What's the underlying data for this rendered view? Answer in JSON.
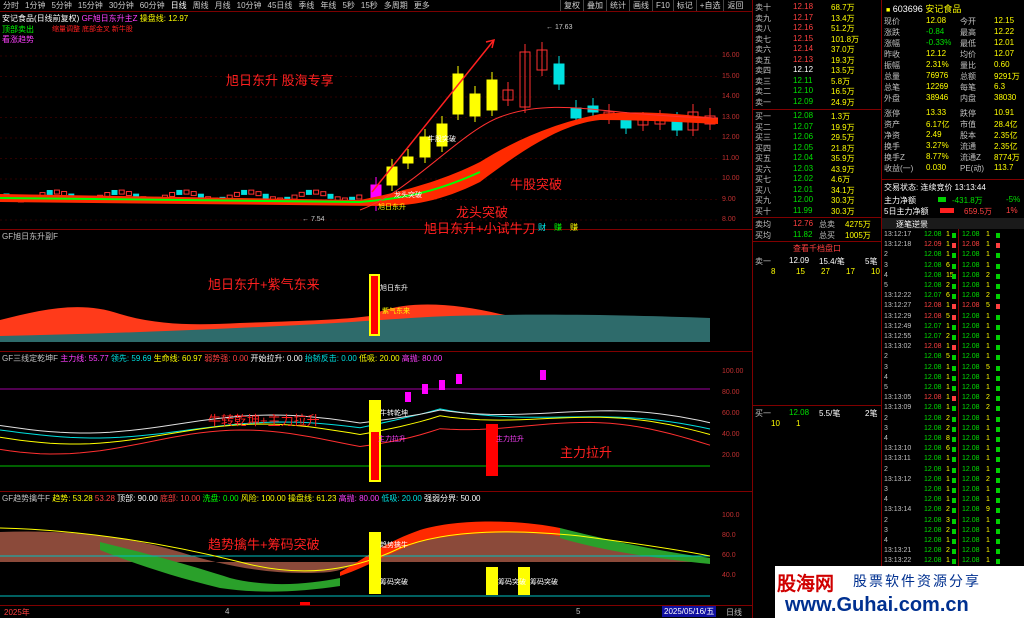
{
  "topbar": {
    "periods": [
      "分时",
      "1分钟",
      "5分钟",
      "15分钟",
      "30分钟",
      "60分钟",
      "日线",
      "周线",
      "月线",
      "10分钟",
      "45日线",
      "季线",
      "年线",
      "5秒",
      "15秒",
      "多周期",
      "更多"
    ],
    "tools": [
      "复权",
      "叠加",
      "统计",
      "画线",
      "F10",
      "标记",
      "+自选",
      "返回"
    ]
  },
  "main_pane": {
    "title": "安记食品(日线前复权)",
    "indicator": "GF旭日东升主Z",
    "indicator_label": "操盘线: 12.97",
    "legend": [
      "顶部卖出",
      "看涨趋势"
    ],
    "subtitle_line": "缩量调整 底部金叉 新牛股",
    "y_ticks": [
      "16.00",
      "15.00",
      "14.00",
      "13.00",
      "12.00",
      "11.00",
      "10.00",
      "9.00",
      "8.00"
    ],
    "max_label": "17.63",
    "min_label": "7.54",
    "annotations": [
      "旭日东升 股海专享",
      "牛股突破",
      "龙头突破",
      "旭日东升+小试牛刀"
    ],
    "mini_labels": [
      "牛股突破",
      "龙头突破",
      "旭日东升"
    ],
    "side_labels": [
      "财",
      "赚",
      "赚"
    ]
  },
  "pane2": {
    "title": "GF旭日东升副F",
    "annotation": "旭日东升+紫气东来",
    "labels": [
      "旭日东升",
      "紫气东来"
    ]
  },
  "pane3": {
    "title": "GF三线定乾坤F",
    "params": [
      "主力线: 55.77",
      "领先: 59.69",
      "生命线: 60.97",
      "弱势强: 0.00",
      "开始拉升: 0.00",
      "抬轿反击: 0.00",
      "低吸: 20.00",
      "高抛: 80.00"
    ],
    "y_ticks": [
      "100.00",
      "80.00",
      "60.00",
      "40.00",
      "20.00"
    ],
    "annotations": [
      "牛转乾坤+主力拉升",
      "主力拉升"
    ],
    "labels": [
      "牛转乾坤",
      "主力拉升",
      "主力拉升"
    ]
  },
  "pane4": {
    "title": "GF趋势擒牛F",
    "params": [
      "趋势: 53.28",
      "53.28",
      "顶部: 90.00",
      "底部: 10.00",
      "洗盘: 0.00",
      "风险: 100.00",
      "操盘线: 61.23",
      "高抛: 80.00",
      "低吸: 20.00",
      "强弱分界: 50.00"
    ],
    "y_ticks": [
      "100.0",
      "80.0",
      "60.0",
      "40.0"
    ],
    "annotation": "趋势擒牛+筹码突破",
    "labels": [
      "趋势擒牛",
      "筹码突破",
      "筹码突破",
      "筹码突破"
    ]
  },
  "footer": {
    "left": "2025年",
    "tick1": "4",
    "tick2": "5",
    "date": "2025/05/16/五",
    "right": "日线"
  },
  "stock": {
    "code": "603696",
    "name": "安记食品"
  },
  "orderbook": {
    "asks": [
      {
        "label": "卖十",
        "price": "12.18",
        "vol": "68.7万"
      },
      {
        "label": "卖九",
        "price": "12.17",
        "vol": "13.4万"
      },
      {
        "label": "卖八",
        "price": "12.16",
        "vol": "51.2万"
      },
      {
        "label": "卖七",
        "price": "12.15",
        "vol": "101.8万"
      },
      {
        "label": "卖六",
        "price": "12.14",
        "vol": "37.0万"
      },
      {
        "label": "卖五",
        "price": "12.13",
        "vol": "19.3万"
      },
      {
        "label": "卖四",
        "price": "12.12",
        "vol": "13.5万"
      },
      {
        "label": "卖三",
        "price": "12.11",
        "vol": "5.8万"
      },
      {
        "label": "卖二",
        "price": "12.10",
        "vol": "16.5万"
      },
      {
        "label": "卖一",
        "price": "12.09",
        "vol": "24.9万"
      }
    ],
    "bids": [
      {
        "label": "买一",
        "price": "12.08",
        "vol": "1.3万"
      },
      {
        "label": "买二",
        "price": "12.07",
        "vol": "19.9万"
      },
      {
        "label": "买三",
        "price": "12.06",
        "vol": "29.5万"
      },
      {
        "label": "买四",
        "price": "12.05",
        "vol": "21.8万"
      },
      {
        "label": "买五",
        "price": "12.04",
        "vol": "35.9万"
      },
      {
        "label": "买六",
        "price": "12.03",
        "vol": "43.9万"
      },
      {
        "label": "买七",
        "price": "12.02",
        "vol": "4.6万"
      },
      {
        "label": "买八",
        "price": "12.01",
        "vol": "34.1万"
      },
      {
        "label": "买九",
        "price": "12.00",
        "vol": "30.3万"
      },
      {
        "label": "买十",
        "price": "11.99",
        "vol": "30.3万"
      }
    ],
    "avg_ask": {
      "label": "卖均",
      "price": "12.76",
      "tot_label": "总卖",
      "tot": "4275万"
    },
    "avg_bid": {
      "label": "买均",
      "price": "11.82",
      "tot_label": "总买",
      "tot": "1005万"
    },
    "view_queue": "查看千档盘口",
    "sell1_queue": {
      "label": "卖一",
      "price": "12.09",
      "vol": "15.4/笔",
      "cnt": "5笔",
      "nums": [
        "8",
        "15",
        "27",
        "17",
        "10"
      ]
    },
    "buy1_queue": {
      "label": "买一",
      "price": "12.08",
      "vol": "5.5/笔",
      "cnt": "2笔",
      "nums": [
        "10",
        "1"
      ]
    }
  },
  "quote": {
    "rows": [
      {
        "l": "现价",
        "lv": "12.08",
        "r": "今开",
        "rv": "12.15"
      },
      {
        "l": "涨跌",
        "lv": "-0.84",
        "r": "最高",
        "rv": "12.22"
      },
      {
        "l": "涨幅",
        "lv": "-0.33%",
        "r": "最低",
        "rv": "12.01"
      },
      {
        "l": "昨收",
        "lv": "12.12",
        "r": "均价",
        "rv": "12.07"
      },
      {
        "l": "振幅",
        "lv": "2.31%",
        "r": "量比",
        "rv": "0.60"
      },
      {
        "l": "总量",
        "lv": "76976",
        "r": "总额",
        "rv": "9291万"
      },
      {
        "l": "总笔",
        "lv": "12269",
        "r": "每笔",
        "rv": "6.3"
      },
      {
        "l": "外盘",
        "lv": "38946",
        "r": "内盘",
        "rv": "38030"
      },
      {
        "l": "涨停",
        "lv": "13.33",
        "r": "跌停",
        "rv": "10.91"
      },
      {
        "l": "资产",
        "lv": "6.17亿",
        "r": "市值",
        "rv": "28.4亿"
      },
      {
        "l": "净资",
        "lv": "2.49",
        "r": "股本",
        "rv": "2.35亿"
      },
      {
        "l": "换手",
        "lv": "3.27%",
        "r": "流通",
        "rv": "2.35亿"
      },
      {
        "l": "换手Z",
        "lv": "8.77%",
        "r": "流通Z",
        "rv": "8774万"
      },
      {
        "l": "收益(一)",
        "lv": "0.030",
        "r": "PE(动)",
        "rv": "113.7"
      }
    ],
    "trade_status": "交易状态: 连续竞价 13:13:44",
    "main_net": {
      "label": "主力净额",
      "val": "-431.8万",
      "pct": "-5%"
    },
    "main_net5": {
      "label": "5日主力净额",
      "val": "659.5万",
      "pct": "1%"
    },
    "tick_header": "逐笔逆景"
  },
  "ticks": [
    {
      "t": "13:12:17",
      "p": "12.08",
      "v": "1",
      "c": "#00d000"
    },
    {
      "t": "13:12:18",
      "p": "12.09",
      "v": "1",
      "c": "#ff4040"
    },
    {
      "t": "2",
      "p": "12.08",
      "v": "1",
      "c": "#00d000"
    },
    {
      "t": "3",
      "p": "12.08",
      "v": "6",
      "c": "#00d000"
    },
    {
      "t": "4",
      "p": "12.08",
      "v": "15",
      "c": "#00d000"
    },
    {
      "t": "5",
      "p": "12.08",
      "v": "2",
      "c": "#00d000"
    },
    {
      "t": "13:12:22",
      "p": "12.07",
      "v": "6",
      "c": "#00d000"
    },
    {
      "t": "13:12:27",
      "p": "12.08",
      "v": "1",
      "c": "#ff4040"
    },
    {
      "t": "13:12:29",
      "p": "12.08",
      "v": "5",
      "c": "#ff4040"
    },
    {
      "t": "13:12:49",
      "p": "12.07",
      "v": "1",
      "c": "#00d000"
    },
    {
      "t": "13:12:55",
      "p": "12.07",
      "v": "2",
      "c": "#00d000"
    },
    {
      "t": "13:13:02",
      "p": "12.08",
      "v": "1",
      "c": "#ff4040"
    },
    {
      "t": "2",
      "p": "12.08",
      "v": "5",
      "c": "#00d000"
    },
    {
      "t": "3",
      "p": "12.08",
      "v": "1",
      "c": "#00d000"
    },
    {
      "t": "4",
      "p": "12.08",
      "v": "1",
      "c": "#00d000"
    },
    {
      "t": "5",
      "p": "12.08",
      "v": "1",
      "c": "#00d000"
    },
    {
      "t": "13:13:05",
      "p": "12.08",
      "v": "1",
      "c": "#ff4040"
    },
    {
      "t": "13:13:09",
      "p": "12.08",
      "v": "1",
      "c": "#00d000"
    },
    {
      "t": "2",
      "p": "12.08",
      "v": "2",
      "c": "#00d000"
    },
    {
      "t": "3",
      "p": "12.08",
      "v": "2",
      "c": "#00d000"
    },
    {
      "t": "4",
      "p": "12.08",
      "v": "8",
      "c": "#00d000"
    },
    {
      "t": "13:13:10",
      "p": "12.08",
      "v": "6",
      "c": "#00d000"
    },
    {
      "t": "13:13:11",
      "p": "12.08",
      "v": "1",
      "c": "#00d000"
    },
    {
      "t": "2",
      "p": "12.08",
      "v": "1",
      "c": "#00d000"
    },
    {
      "t": "13:13:12",
      "p": "12.08",
      "v": "1",
      "c": "#00d000"
    },
    {
      "t": "3",
      "p": "12.08",
      "v": "1",
      "c": "#00d000"
    },
    {
      "t": "4",
      "p": "12.08",
      "v": "1",
      "c": "#00d000"
    },
    {
      "t": "13:13:14",
      "p": "12.08",
      "v": "2",
      "c": "#00d000"
    },
    {
      "t": "2",
      "p": "12.08",
      "v": "3",
      "c": "#00d000"
    },
    {
      "t": "3",
      "p": "12.08",
      "v": "2",
      "c": "#00d000"
    },
    {
      "t": "4",
      "p": "12.08",
      "v": "1",
      "c": "#00d000"
    },
    {
      "t": "13:13:21",
      "p": "12.08",
      "v": "2",
      "c": "#00d000"
    },
    {
      "t": "13:13:22",
      "p": "12.08",
      "v": "1",
      "c": "#00d000"
    }
  ],
  "ticks2": [
    {
      "p": "12.08",
      "v": "1",
      "c": "#00d000"
    },
    {
      "p": "12.08",
      "v": "1",
      "c": "#ff4040"
    },
    {
      "p": "12.08",
      "v": "1",
      "c": "#00d000"
    },
    {
      "p": "12.08",
      "v": "1",
      "c": "#00d000"
    },
    {
      "p": "12.08",
      "v": "2",
      "c": "#00d000"
    },
    {
      "p": "12.08",
      "v": "1",
      "c": "#00d000"
    },
    {
      "p": "12.08",
      "v": "2",
      "c": "#00d000"
    },
    {
      "p": "12.08",
      "v": "5",
      "c": "#ff4040"
    },
    {
      "p": "12.08",
      "v": "1",
      "c": "#00d000"
    },
    {
      "p": "12.08",
      "v": "1",
      "c": "#00d000"
    },
    {
      "p": "12.08",
      "v": "1",
      "c": "#00d000"
    },
    {
      "p": "12.08",
      "v": "1",
      "c": "#00d000"
    },
    {
      "p": "12.08",
      "v": "1",
      "c": "#00d000"
    },
    {
      "p": "12.08",
      "v": "5",
      "c": "#00d000"
    },
    {
      "p": "12.08",
      "v": "1",
      "c": "#00d000"
    },
    {
      "p": "12.08",
      "v": "1",
      "c": "#00d000"
    },
    {
      "p": "12.08",
      "v": "2",
      "c": "#00d000"
    },
    {
      "p": "12.08",
      "v": "2",
      "c": "#00d000"
    },
    {
      "p": "12.08",
      "v": "1",
      "c": "#00d000"
    },
    {
      "p": "12.08",
      "v": "1",
      "c": "#00d000"
    },
    {
      "p": "12.08",
      "v": "1",
      "c": "#00d000"
    },
    {
      "p": "12.08",
      "v": "1",
      "c": "#00d000"
    },
    {
      "p": "12.08",
      "v": "1",
      "c": "#00d000"
    },
    {
      "p": "12.08",
      "v": "1",
      "c": "#00d000"
    },
    {
      "p": "12.08",
      "v": "2",
      "c": "#00d000"
    },
    {
      "p": "12.08",
      "v": "1",
      "c": "#00d000"
    },
    {
      "p": "12.08",
      "v": "1",
      "c": "#00d000"
    },
    {
      "p": "12.08",
      "v": "9",
      "c": "#00d000"
    },
    {
      "p": "12.08",
      "v": "1",
      "c": "#00d000"
    },
    {
      "p": "12.08",
      "v": "1",
      "c": "#00d000"
    },
    {
      "p": "12.08",
      "v": "1",
      "c": "#00d000"
    },
    {
      "p": "12.08",
      "v": "1",
      "c": "#00d000"
    },
    {
      "p": "12.08",
      "v": "1",
      "c": "#00d000"
    }
  ],
  "watermark": {
    "brand": "股海网",
    "slogan": "股票软件资源分享",
    "url": "www.Guhai.com.cn"
  },
  "colors": {
    "up": "#ff3030",
    "down": "#00e0e0",
    "yellow": "#ffff00",
    "magenta": "#ff00ff",
    "bg": "#000000",
    "grid": "#800000"
  }
}
